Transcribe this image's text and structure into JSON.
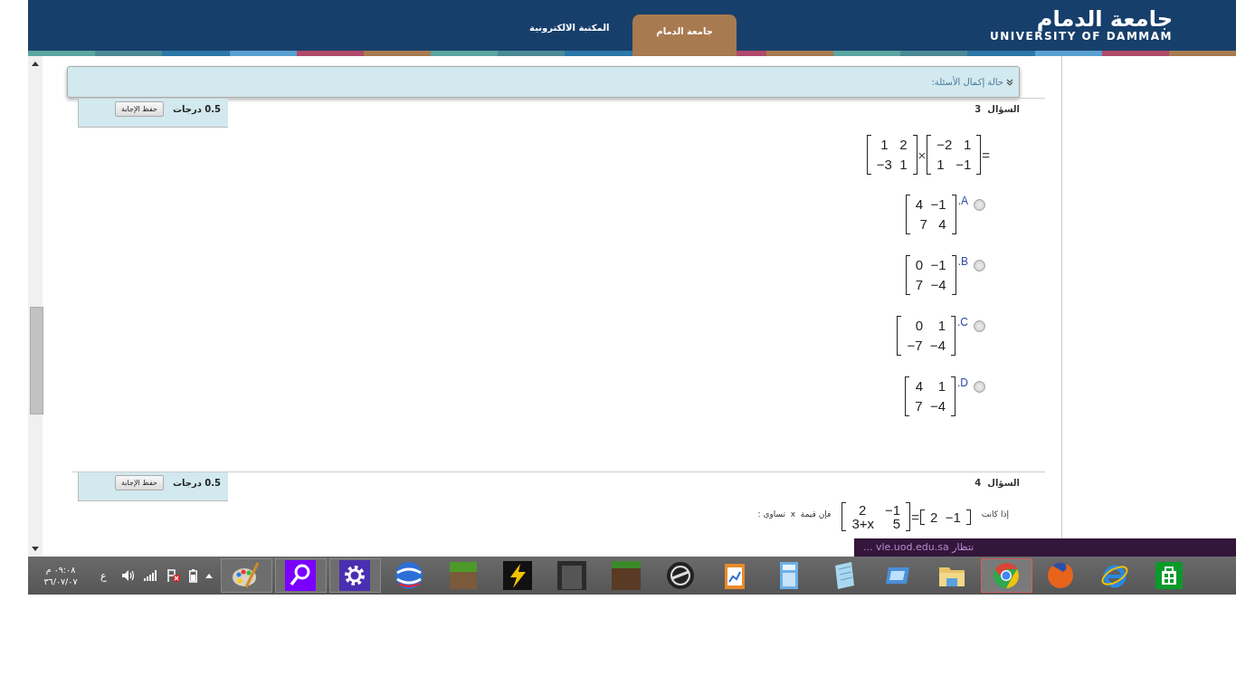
{
  "header": {
    "logo_arabic": "جامعة الدمام",
    "logo_english": "UNIVERSITY OF DAMMAM",
    "tabs": [
      {
        "label": "جامعة الدمام",
        "selected": true
      },
      {
        "label": "المكتبة الالكترونية",
        "selected": false
      }
    ]
  },
  "status_panel": {
    "label": "حالة إكمال الأسئلة:"
  },
  "questions": [
    {
      "kind": "matrix-product",
      "title": "السؤال",
      "number": "3",
      "points": "0.5 درجات",
      "save_button": "حفظ الإجابة",
      "left_matrix": [
        "1   2",
        "−3  1"
      ],
      "operator": "×",
      "right_matrix": [
        "−2   1",
        "1   −1"
      ],
      "equals": "=",
      "options": [
        {
          "letter": "A.",
          "matrix": [
            "4  −1",
            "7   4"
          ],
          "selected": false
        },
        {
          "letter": "B.",
          "matrix": [
            "0  −1",
            "7  −4"
          ],
          "selected": false
        },
        {
          "letter": "C.",
          "matrix": [
            "0    1",
            "−7  −4"
          ],
          "selected": false
        },
        {
          "letter": "D.",
          "matrix": [
            "4    1",
            "7  −4"
          ],
          "selected": false
        }
      ]
    },
    {
      "kind": "matrix-equation",
      "title": "السؤال",
      "number": "4",
      "points": "0.5 درجات",
      "save_button": "حفظ الإجابة",
      "prefix": "إذا كانت",
      "left_matrix": [
        "2     −1",
        "3+x     5"
      ],
      "equals": "=",
      "right_matrix": [
        "2  −1"
      ],
      "suffix": "فإن قيمة  x  تساوي :"
    }
  ],
  "status_bar": {
    "text": "نتظار vle.uod.edu.sa ..."
  },
  "taskbar": {
    "time": "٠٩:٠٨ م",
    "date": "٣٦/٠٧/٠٧",
    "language": "ع",
    "apps": [
      {
        "kind": "paint",
        "open": true,
        "selected": false
      },
      {
        "kind": "search",
        "open": true,
        "selected": false
      },
      {
        "kind": "settings",
        "open": true,
        "selected": false
      },
      {
        "kind": "swirl",
        "open": false,
        "selected": false
      },
      {
        "kind": "grass",
        "open": false,
        "selected": false
      },
      {
        "kind": "lightning",
        "open": false,
        "selected": false
      },
      {
        "kind": "dark",
        "open": false,
        "selected": false
      },
      {
        "kind": "block",
        "open": false,
        "selected": false
      },
      {
        "kind": "wheel",
        "open": false,
        "selected": false
      },
      {
        "kind": "clipboard",
        "open": false,
        "selected": false
      },
      {
        "kind": "calculator",
        "open": false,
        "selected": false
      },
      {
        "kind": "notepad",
        "open": false,
        "selected": false
      },
      {
        "kind": "window",
        "open": false,
        "selected": false
      },
      {
        "kind": "folder",
        "open": false,
        "selected": false
      },
      {
        "kind": "chrome",
        "open": false,
        "selected": true
      },
      {
        "kind": "firefox",
        "open": false,
        "selected": false
      },
      {
        "kind": "ie",
        "open": false,
        "selected": false
      },
      {
        "kind": "store",
        "open": false,
        "selected": false
      }
    ]
  }
}
